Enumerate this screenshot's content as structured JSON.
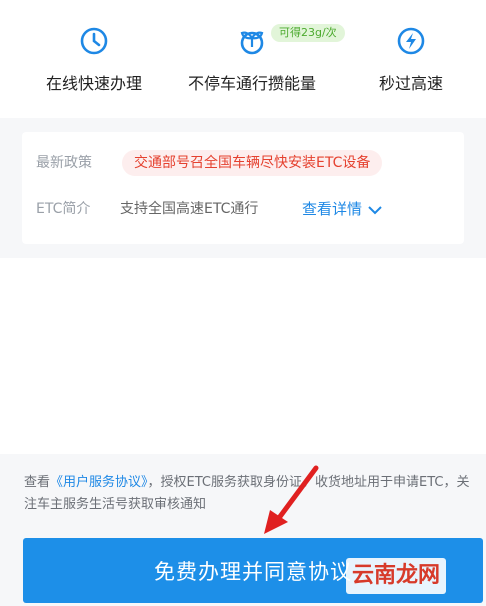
{
  "features": [
    {
      "icon": "clock-icon",
      "label": "在线快速办理"
    },
    {
      "icon": "leaf-sprout-icon",
      "label": "不停车通行攒能量"
    },
    {
      "icon": "lightning-icon",
      "label": "秒过高速"
    }
  ],
  "energy_badge": "可得23g/次",
  "policy": {
    "label": "最新政策",
    "text": "交通部号召全国车辆尽快安装ETC设备"
  },
  "intro": {
    "label": "ETC简介",
    "text": "支持全国高速ETC通行",
    "more": "查看详情"
  },
  "agreement": {
    "prefix": "查看",
    "link": "《用户服务协议》",
    "suffix": "，授权ETC服务获取身份证、收货地址用于申请ETC，关注车主服务生活号获取审核通知"
  },
  "submit_label": "免费办理并同意协议",
  "watermark": "云南龙网",
  "colors": {
    "accent": "#1d8fe8",
    "policy_red": "#e5412f",
    "badge_green": "#4caa2e"
  }
}
